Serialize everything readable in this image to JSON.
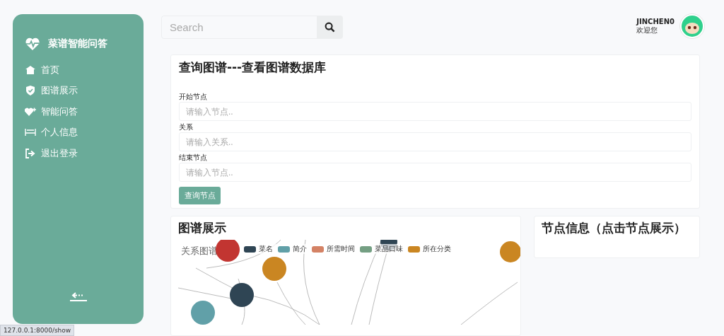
{
  "sidebar": {
    "brand": "菜谱智能问答",
    "items": [
      {
        "label": "首页"
      },
      {
        "label": "图谱展示"
      },
      {
        "label": "智能问答"
      },
      {
        "label": "个人信息"
      },
      {
        "label": "退出登录"
      }
    ]
  },
  "search": {
    "placeholder": "Search"
  },
  "user": {
    "name": "JINCHEN0",
    "greeting": "欢迎您"
  },
  "query": {
    "title": "查询图谱---查看图谱数据库",
    "fields": [
      {
        "label": "开始节点",
        "placeholder": "请输入节点.."
      },
      {
        "label": "关系",
        "placeholder": "请输入关系.."
      },
      {
        "label": "结束节点",
        "placeholder": "请输入节点.."
      }
    ],
    "button": "查询节点"
  },
  "graph": {
    "title": "图谱展示",
    "chart_title": "关系图谱",
    "legend": [
      {
        "label": "菜名",
        "color": "#2f4554"
      },
      {
        "label": "简介",
        "color": "#61a0a8"
      },
      {
        "label": "所需时间",
        "color": "#d48265"
      },
      {
        "label": "菜品口味",
        "color": "#749f83"
      },
      {
        "label": "所在分类",
        "color": "#ca8622"
      }
    ]
  },
  "node_info": {
    "title": "节点信息（点击节点展示）"
  },
  "status_bar": "127.0.0.1:8000/show"
}
